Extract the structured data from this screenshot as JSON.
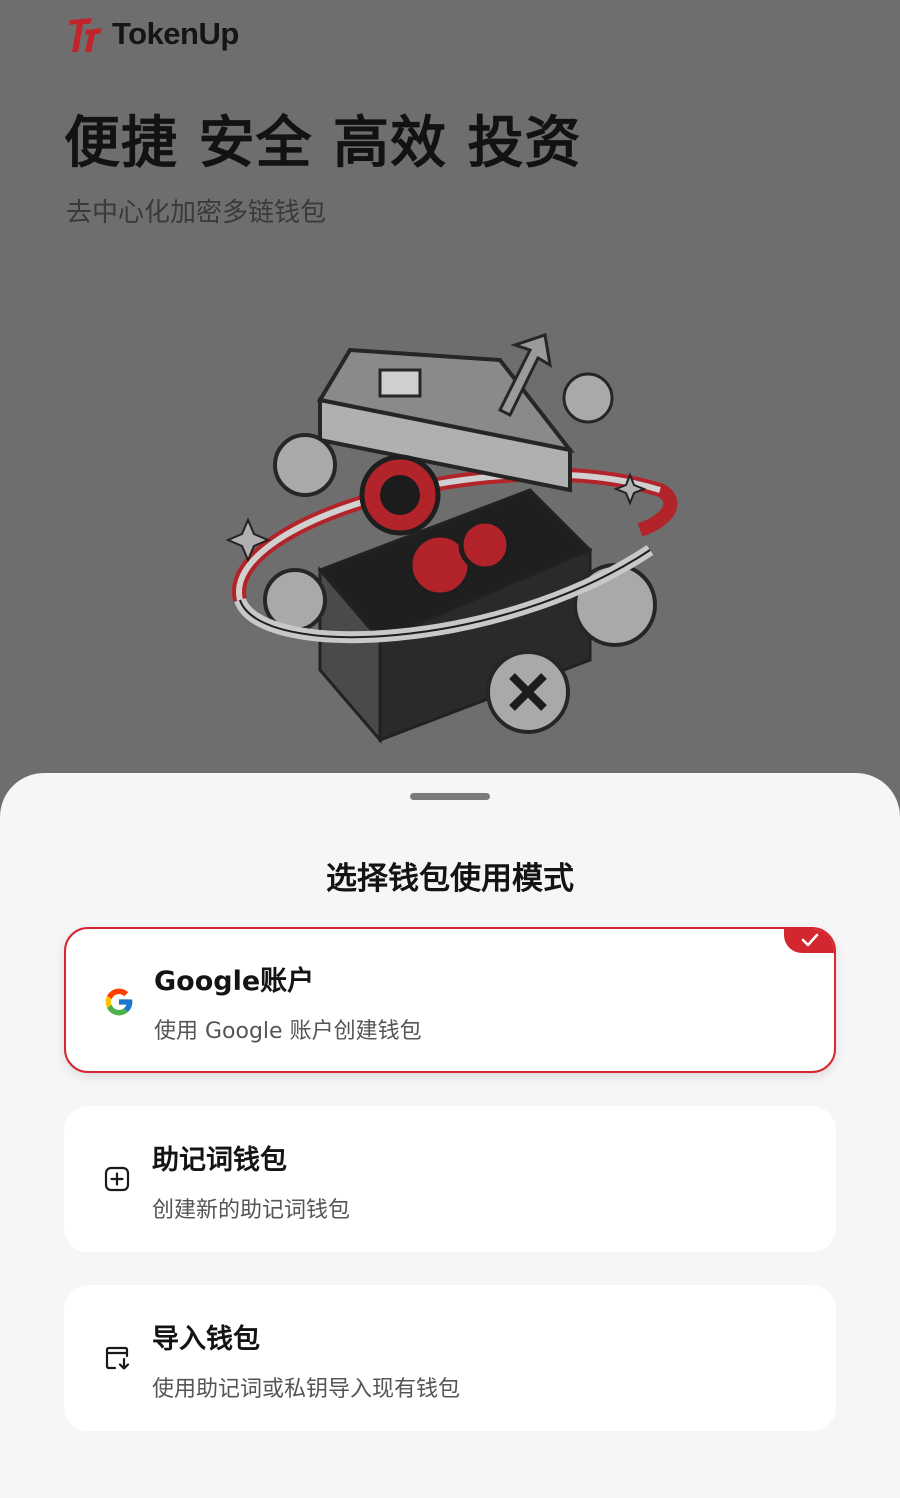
{
  "app": {
    "brand": "TokenUp",
    "headline": "便捷 安全 高效 投资",
    "subtitle": "去中心化加密多链钱包"
  },
  "sheet": {
    "title": "选择钱包使用模式",
    "options": [
      {
        "title": "Google账户",
        "subtitle": "使用 Google 账户创建钱包",
        "icon": "google-icon",
        "selected": true
      },
      {
        "title": "助记词钱包",
        "subtitle": "创建新的助记词钱包",
        "icon": "add-square-icon",
        "selected": false
      },
      {
        "title": "导入钱包",
        "subtitle": "使用助记词或私钥导入现有钱包",
        "icon": "import-icon",
        "selected": false
      }
    ]
  },
  "colors": {
    "accent": "#d4262f",
    "overlay": "#6e6e6e",
    "sheet_bg": "#f6f6f6",
    "card_bg": "#ffffff"
  }
}
